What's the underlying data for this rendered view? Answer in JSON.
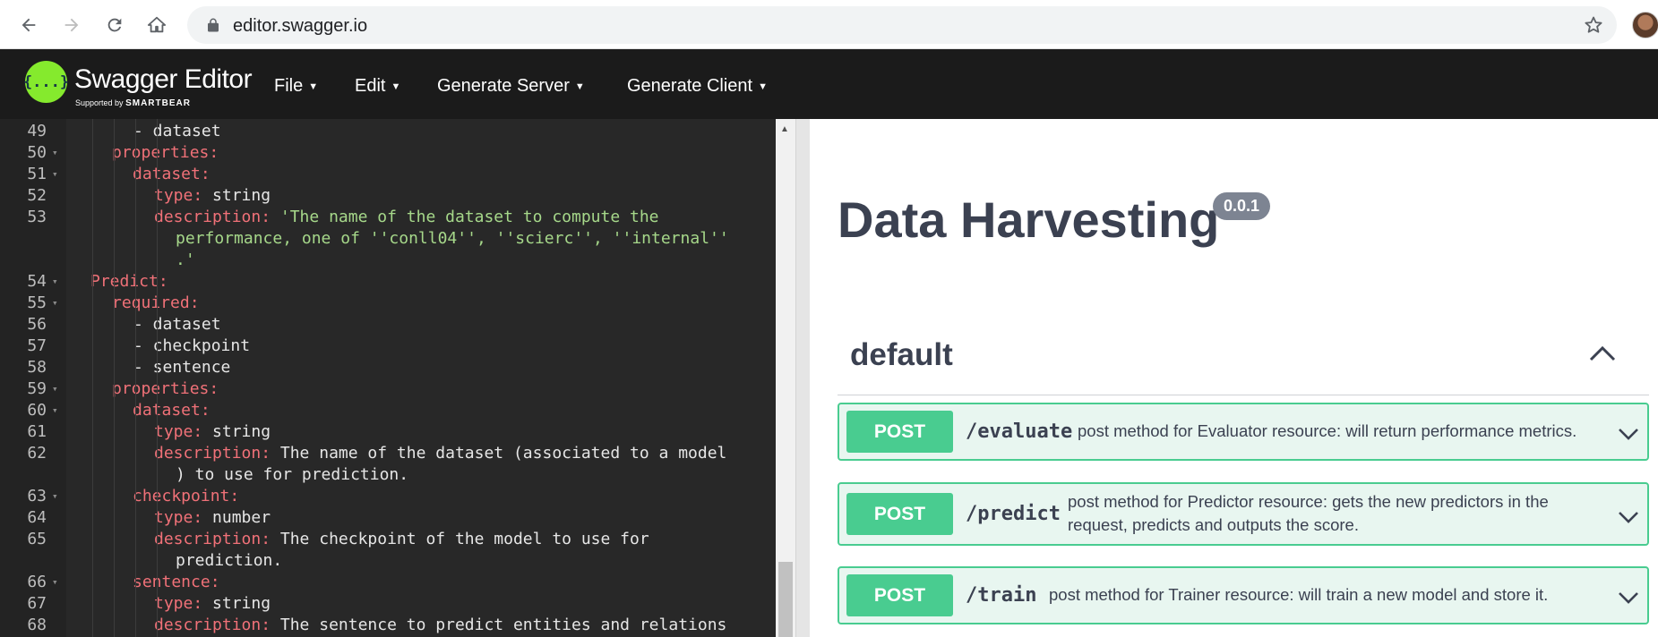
{
  "browser": {
    "url": "editor.swagger.io",
    "icons": [
      "back-icon",
      "forward-icon",
      "reload-icon",
      "home-icon",
      "lock-icon",
      "star-icon"
    ]
  },
  "header": {
    "logo_glyph": "{...}",
    "title": "Swagger Editor",
    "sub_prefix": "Supported by",
    "sub_brand": "SMARTBEAR",
    "menu": [
      {
        "label": "File"
      },
      {
        "label": "Edit"
      },
      {
        "label": "Generate Server"
      },
      {
        "label": "Generate Client"
      }
    ]
  },
  "editor": {
    "lines": [
      {
        "n": "49",
        "parts": [
          [
            "w",
            "- dataset"
          ]
        ]
      },
      {
        "n": "50",
        "parts": [
          [
            "k",
            "properties:"
          ]
        ]
      },
      {
        "n": "51",
        "parts": [
          [
            "k",
            "dataset:"
          ]
        ]
      },
      {
        "n": "52",
        "parts": [
          [
            "k",
            "type:"
          ],
          [
            "w",
            " string"
          ]
        ]
      },
      {
        "n": "53",
        "parts": [
          [
            "k",
            "description:"
          ],
          [
            "s",
            " 'The name of the dataset to compute the"
          ]
        ]
      },
      {
        "n": "",
        "parts": [
          [
            "s",
            "performance, one of ''conll04'', ''scierc'', ''internal''"
          ]
        ]
      },
      {
        "n": "",
        "parts": [
          [
            "s",
            ".'"
          ]
        ]
      },
      {
        "n": "54",
        "parts": [
          [
            "k",
            "Predict:"
          ]
        ]
      },
      {
        "n": "55",
        "parts": [
          [
            "k",
            "required:"
          ]
        ]
      },
      {
        "n": "56",
        "parts": [
          [
            "w",
            "- dataset"
          ]
        ]
      },
      {
        "n": "57",
        "parts": [
          [
            "w",
            "- checkpoint"
          ]
        ]
      },
      {
        "n": "58",
        "parts": [
          [
            "w",
            "- sentence"
          ]
        ]
      },
      {
        "n": "59",
        "parts": [
          [
            "k",
            "properties:"
          ]
        ]
      },
      {
        "n": "60",
        "parts": [
          [
            "k",
            "dataset:"
          ]
        ]
      },
      {
        "n": "61",
        "parts": [
          [
            "k",
            "type:"
          ],
          [
            "w",
            " string"
          ]
        ]
      },
      {
        "n": "62",
        "parts": [
          [
            "k",
            "description:"
          ],
          [
            "w",
            " The name of the dataset (associated to a model"
          ]
        ]
      },
      {
        "n": "",
        "parts": [
          [
            "w",
            ") to use for prediction."
          ]
        ]
      },
      {
        "n": "63",
        "parts": [
          [
            "k",
            "checkpoint:"
          ]
        ]
      },
      {
        "n": "64",
        "parts": [
          [
            "k",
            "type:"
          ],
          [
            "w",
            " number"
          ]
        ]
      },
      {
        "n": "65",
        "parts": [
          [
            "k",
            "description:"
          ],
          [
            "w",
            " The checkpoint of the model to use for"
          ]
        ]
      },
      {
        "n": "",
        "parts": [
          [
            "w",
            "prediction."
          ]
        ]
      },
      {
        "n": "66",
        "parts": [
          [
            "k",
            "sentence:"
          ]
        ]
      },
      {
        "n": "67",
        "parts": [
          [
            "k",
            "type:"
          ],
          [
            "w",
            " string"
          ]
        ]
      },
      {
        "n": "68",
        "parts": [
          [
            "k",
            "description:"
          ],
          [
            "w",
            " The sentence to predict entities and relations"
          ]
        ]
      }
    ]
  },
  "api": {
    "title": "Data Harvesting",
    "version": "0.0.1",
    "tag": "default",
    "operations": [
      {
        "method": "POST",
        "path": "/evaluate",
        "desc": "post method for Evaluator resource: will return performance metrics."
      },
      {
        "method": "POST",
        "path": "/predict",
        "desc": "post method for Predictor resource: gets the new predictors in the request, predicts and outputs the score."
      },
      {
        "method": "POST",
        "path": "/train",
        "desc": "post method for Trainer resource: will train a new model and store it."
      }
    ]
  },
  "colors": {
    "post": "#49cc90",
    "post_bg": "#e8f6f0",
    "header_bg": "#1b1b1b",
    "logo": "#85ea2d",
    "editor_bg": "#282828",
    "yaml_key": "#f07178",
    "yaml_string": "#a6d88a"
  }
}
